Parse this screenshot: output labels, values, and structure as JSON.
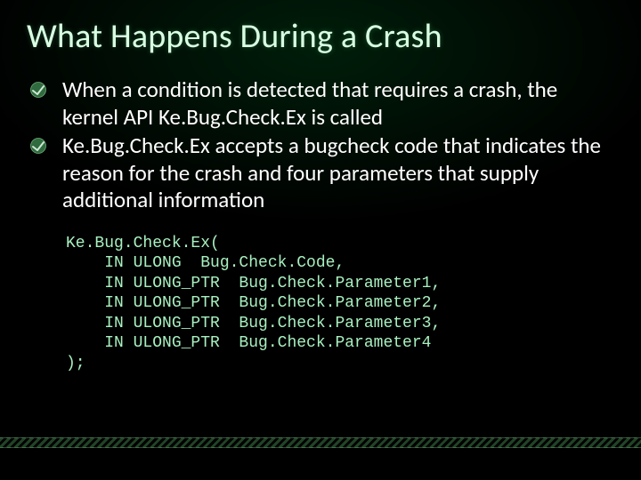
{
  "title": "What Happens During a Crash",
  "bullets": [
    "When a condition is detected that requires a crash, the kernel API Ke.Bug.Check.Ex is called",
    "Ke.Bug.Check.Ex accepts a bugcheck code that indicates the reason for the crash and four parameters that supply additional information"
  ],
  "code": "Ke.Bug.Check.Ex(\n    IN ULONG  Bug.Check.Code,\n    IN ULONG_PTR  Bug.Check.Parameter1,\n    IN ULONG_PTR  Bug.Check.Parameter2,\n    IN ULONG_PTR  Bug.Check.Parameter3,\n    IN ULONG_PTR  Bug.Check.Parameter4\n);"
}
